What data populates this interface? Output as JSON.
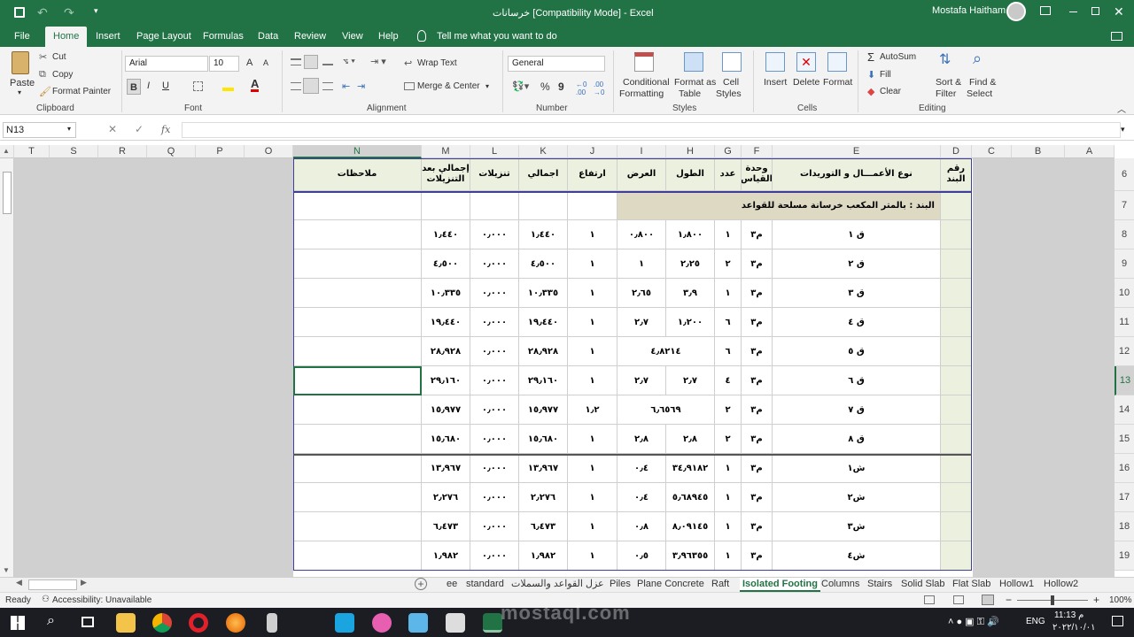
{
  "window": {
    "title": "خرسانات  [Compatibility Mode]  -  Excel",
    "user": "Mostafa Haitham"
  },
  "tabs": [
    "File",
    "Home",
    "Insert",
    "Page Layout",
    "Formulas",
    "Data",
    "Review",
    "View",
    "Help"
  ],
  "tell_me": "Tell me what you want to do",
  "ribbon": {
    "clipboard": {
      "paste": "Paste",
      "cut": "Cut",
      "copy": "Copy",
      "format_painter": "Format Painter",
      "label": "Clipboard"
    },
    "font": {
      "name": "Arial",
      "size": "10",
      "label": "Font",
      "bold": "B",
      "italic": "I",
      "underline": "U"
    },
    "alignment": {
      "wrap": "Wrap Text",
      "merge": "Merge & Center",
      "label": "Alignment"
    },
    "number": {
      "format": "General",
      "label": "Number",
      "percent": "%",
      "comma": "9"
    },
    "styles": {
      "conditional": "Conditional",
      "formatting": "Formatting",
      "format_as": "Format as",
      "table": "Table",
      "cell": "Cell",
      "cell_styles": "Styles",
      "label": "Styles"
    },
    "cells": {
      "insert": "Insert",
      "delete": "Delete",
      "format": "Format",
      "label": "Cells"
    },
    "editing": {
      "autosum": "AutoSum",
      "fill": "Fill",
      "clear": "Clear",
      "sort": "Sort &",
      "filter": "Filter",
      "find": "Find &",
      "select": "Select",
      "label": "Editing"
    }
  },
  "formula_bar": {
    "name_box": "N13",
    "fx": "fx",
    "value": ""
  },
  "columns": [
    "T",
    "S",
    "R",
    "Q",
    "P",
    "O",
    "N",
    "M",
    "L",
    "K",
    "J",
    "I",
    "H",
    "G",
    "F",
    "E",
    "D",
    "C",
    "B",
    "A"
  ],
  "rows": [
    "6",
    "7",
    "8",
    "9",
    "10",
    "11",
    "12",
    "13",
    "14",
    "15",
    "16",
    "17",
    "18",
    "19"
  ],
  "table": {
    "headers": {
      "notes": "ملاحظات",
      "total_after": "إجمالي بعد التنزيلات",
      "deductions": "تنزيلات",
      "total": "اجمالي",
      "height": "ارتفاع",
      "width": "العرض",
      "length": "الطول",
      "count": "عدد",
      "unit": "وحدة القياس",
      "type": "نوع الأعمـــال و التوريدات",
      "item_no": "رقم البند"
    },
    "section_title": "البند : بالمتر المكعب خرسانة مسلحة للقواعد",
    "rows": [
      {
        "name": "ق ١",
        "unit": "م٣",
        "count": "١",
        "length": "١٫٨٠٠",
        "width": "٠٫٨٠٠",
        "height": "١",
        "total": "١٫٤٤٠",
        "ded": "٠٫٠٠٠",
        "net": "١٫٤٤٠"
      },
      {
        "name": "ق ٢",
        "unit": "م٣",
        "count": "٢",
        "length": "٢٫٢٥",
        "width": "١",
        "height": "١",
        "total": "٤٫٥٠٠",
        "ded": "٠٫٠٠٠",
        "net": "٤٫٥٠٠"
      },
      {
        "name": "ق ٣",
        "unit": "م٣",
        "count": "١",
        "length": "٣٫٩",
        "width": "٢٫٦٥",
        "height": "١",
        "total": "١٠٫٣٣٥",
        "ded": "٠٫٠٠٠",
        "net": "١٠٫٣٣٥"
      },
      {
        "name": "ق ٤",
        "unit": "م٣",
        "count": "٦",
        "length": "١٫٢٠٠",
        "width": "٢٫٧",
        "height": "١",
        "total": "١٩٫٤٤٠",
        "ded": "٠٫٠٠٠",
        "net": "١٩٫٤٤٠"
      },
      {
        "name": "ق ٥",
        "unit": "م٣",
        "count": "٦",
        "merged": "٤٫٨٢١٤",
        "height": "١",
        "total": "٢٨٫٩٢٨",
        "ded": "٠٫٠٠٠",
        "net": "٢٨٫٩٢٨"
      },
      {
        "name": "ق ٦",
        "unit": "م٣",
        "count": "٤",
        "length": "٢٫٧",
        "width": "٢٫٧",
        "height": "١",
        "total": "٢٩٫١٦٠",
        "ded": "٠٫٠٠٠",
        "net": "٢٩٫١٦٠"
      },
      {
        "name": "ق ٧",
        "unit": "م٣",
        "count": "٢",
        "merged": "٦٫٦٥٦٩",
        "height": "١٫٢",
        "total": "١٥٫٩٧٧",
        "ded": "٠٫٠٠٠",
        "net": "١٥٫٩٧٧"
      },
      {
        "name": "ق ٨",
        "unit": "م٣",
        "count": "٢",
        "length": "٢٫٨",
        "width": "٢٫٨",
        "height": "١",
        "total": "١٥٫٦٨٠",
        "ded": "٠٫٠٠٠",
        "net": "١٥٫٦٨٠"
      },
      {
        "name": "ش١",
        "unit": "م٣",
        "count": "١",
        "length": "٣٤٫٩١٨٢",
        "width": "٠٫٤",
        "height": "١",
        "total": "١٣٫٩٦٧",
        "ded": "٠٫٠٠٠",
        "net": "١٣٫٩٦٧"
      },
      {
        "name": "ش٢",
        "unit": "م٣",
        "count": "١",
        "length": "٥٫٦٨٩٤٥",
        "width": "٠٫٤",
        "height": "١",
        "total": "٢٫٢٧٦",
        "ded": "٠٫٠٠٠",
        "net": "٢٫٢٧٦"
      },
      {
        "name": "ش٣",
        "unit": "م٣",
        "count": "١",
        "length": "٨٫٠٩١٤٥",
        "width": "٠٫٨",
        "height": "١",
        "total": "٦٫٤٧٣",
        "ded": "٠٫٠٠٠",
        "net": "٦٫٤٧٣"
      },
      {
        "name": "ش٤",
        "unit": "م٣",
        "count": "١",
        "length": "٣٫٩٦٣٥٥",
        "width": "٠٫٥",
        "height": "١",
        "total": "١٫٩٨٢",
        "ded": "٠٫٠٠٠",
        "net": "١٫٩٨٢"
      }
    ]
  },
  "sheet_tabs": [
    "ee",
    "standard",
    "عزل القواعد والسملات",
    "Piles",
    "Plane Concrete",
    "Raft",
    "Isolated Footing",
    "Columns",
    "Stairs",
    "Solid Slab",
    "Flat Slab",
    "Hollow1",
    "Hollow2"
  ],
  "active_sheet": "Isolated Footing",
  "status": {
    "ready": "Ready",
    "accessibility": "Accessibility: Unavailable",
    "zoom": "100%"
  },
  "taskbar": {
    "lang": "ENG",
    "time": "11:13 م",
    "date": "٢٠٢٢/١٠/٠١"
  },
  "watermark": "mostaql.com",
  "colors": {
    "excel_green": "#217346",
    "header_fill": "#ebf1de",
    "section_fill": "#ddd9c3",
    "selection": "#217346"
  }
}
